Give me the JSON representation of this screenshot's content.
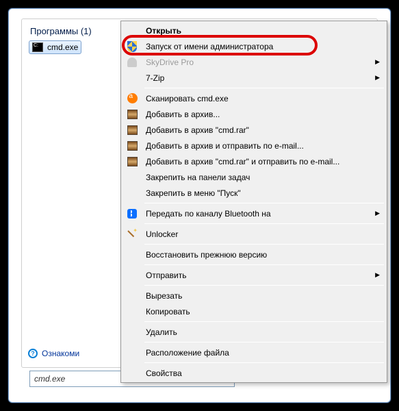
{
  "startPanel": {
    "sectionTitle": "Программы (1)",
    "result": {
      "name": "cmd.exe"
    },
    "moreLinkPrefix": "Ознакоми",
    "search": {
      "value": "cmd.exe"
    }
  },
  "contextMenu": {
    "items": [
      {
        "id": "open",
        "label": "Открыть",
        "bold": true,
        "icon": null,
        "sub": false
      },
      {
        "id": "run-as-admin",
        "label": "Запуск от имени администратора",
        "bold": false,
        "icon": "shield",
        "sub": false,
        "highlighted": true
      },
      {
        "id": "skydrive-pro",
        "label": "SkyDrive Pro",
        "bold": false,
        "icon": "person",
        "sub": true,
        "disabled": true
      },
      {
        "id": "seven-zip",
        "label": "7-Zip",
        "bold": false,
        "icon": null,
        "sub": true
      },
      {
        "id": "sep1",
        "type": "sep"
      },
      {
        "id": "avast-scan",
        "label": "Сканировать cmd.exe",
        "bold": false,
        "icon": "avast",
        "sub": false
      },
      {
        "id": "rar-add",
        "label": "Добавить в архив...",
        "bold": false,
        "icon": "winrar",
        "sub": false
      },
      {
        "id": "rar-add-cmd",
        "label": "Добавить в архив \"cmd.rar\"",
        "bold": false,
        "icon": "winrar",
        "sub": false
      },
      {
        "id": "rar-add-email",
        "label": "Добавить в архив и отправить по e-mail...",
        "bold": false,
        "icon": "winrar",
        "sub": false
      },
      {
        "id": "rar-add-cmd-email",
        "label": "Добавить в архив \"cmd.rar\" и отправить по e-mail...",
        "bold": false,
        "icon": "winrar",
        "sub": false
      },
      {
        "id": "pin-taskbar",
        "label": "Закрепить на панели задач",
        "bold": false,
        "icon": null,
        "sub": false
      },
      {
        "id": "pin-start",
        "label": "Закрепить в меню \"Пуск\"",
        "bold": false,
        "icon": null,
        "sub": false
      },
      {
        "id": "sep2",
        "type": "sep"
      },
      {
        "id": "bluetooth-send",
        "label": "Передать по каналу Bluetooth на",
        "bold": false,
        "icon": "bt",
        "sub": true
      },
      {
        "id": "sep3",
        "type": "sep"
      },
      {
        "id": "unlocker",
        "label": "Unlocker",
        "bold": false,
        "icon": "wand",
        "sub": false
      },
      {
        "id": "sep4",
        "type": "sep"
      },
      {
        "id": "restore-prev",
        "label": "Восстановить прежнюю версию",
        "bold": false,
        "icon": null,
        "sub": false
      },
      {
        "id": "sep5",
        "type": "sep"
      },
      {
        "id": "send-to",
        "label": "Отправить",
        "bold": false,
        "icon": null,
        "sub": true
      },
      {
        "id": "sep6",
        "type": "sep"
      },
      {
        "id": "cut",
        "label": "Вырезать",
        "bold": false,
        "icon": null,
        "sub": false
      },
      {
        "id": "copy",
        "label": "Копировать",
        "bold": false,
        "icon": null,
        "sub": false
      },
      {
        "id": "sep7",
        "type": "sep"
      },
      {
        "id": "delete",
        "label": "Удалить",
        "bold": false,
        "icon": null,
        "sub": false
      },
      {
        "id": "sep8",
        "type": "sep"
      },
      {
        "id": "open-location",
        "label": "Расположение файла",
        "bold": false,
        "icon": null,
        "sub": false
      },
      {
        "id": "sep9",
        "type": "sep"
      },
      {
        "id": "properties",
        "label": "Свойства",
        "bold": false,
        "icon": null,
        "sub": false
      }
    ]
  },
  "annotation": {
    "highlightColor": "#dc0000"
  }
}
